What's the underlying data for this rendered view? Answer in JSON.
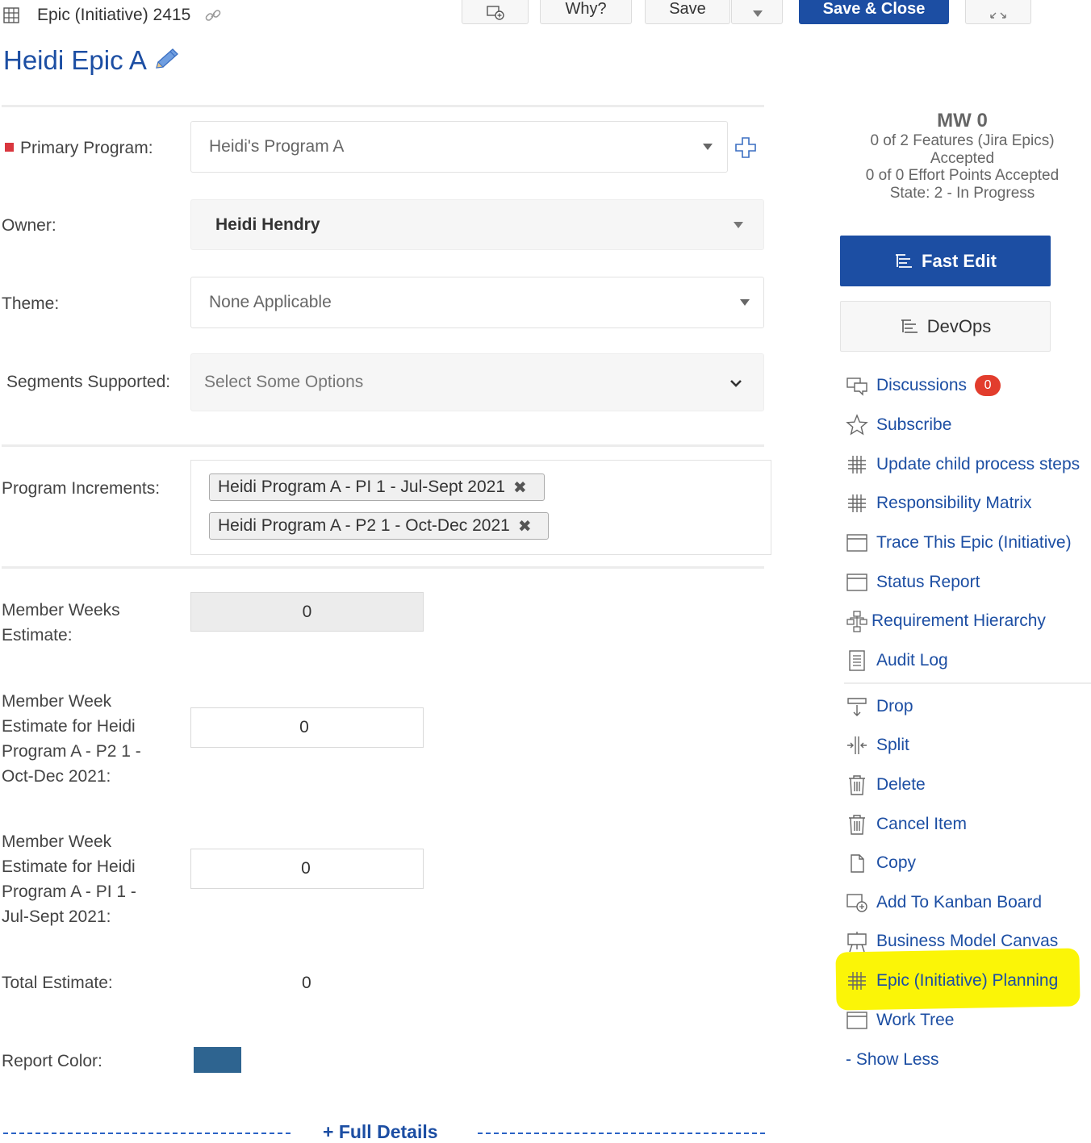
{
  "header": {
    "item_type_id": "Epic (Initiative) 2415",
    "title": "Heidi Epic A",
    "buttons": {
      "why": "Why?",
      "save": "Save",
      "save_close": "Save & Close"
    }
  },
  "form": {
    "primary_program": {
      "label": "Primary Program:",
      "value": "Heidi's Program A"
    },
    "owner": {
      "label": "Owner:",
      "value": "Heidi Hendry"
    },
    "theme": {
      "label": "Theme:",
      "value": "None Applicable"
    },
    "segments": {
      "label": "Segments Supported:",
      "placeholder": "Select Some Options"
    },
    "program_increments": {
      "label": "Program Increments:",
      "tags": [
        "Heidi Program A - PI 1 - Jul-Sept 2021",
        "Heidi Program A - P2 1 - Oct-Dec 2021"
      ]
    },
    "member_weeks": {
      "label_lines": [
        "Member Weeks",
        "Estimate:"
      ],
      "value": "0"
    },
    "mw_p2": {
      "label_lines": [
        "Member Week",
        "Estimate for Heidi",
        "Program A - P2 1 -",
        "Oct-Dec 2021:"
      ],
      "value": "0"
    },
    "mw_pi1": {
      "label_lines": [
        "Member Week",
        "Estimate for Heidi",
        "Program A - PI 1 -",
        "Jul-Sept 2021:"
      ],
      "value": "0"
    },
    "total": {
      "label": "Total Estimate:",
      "value": "0"
    },
    "report_color": {
      "label": "Report Color:",
      "color": "#2e6490"
    },
    "full_details": "+ Full Details"
  },
  "sidebar": {
    "stats": {
      "mw": "MW 0",
      "features": "0 of 2 Features (Jira Epics)",
      "accepted": "Accepted",
      "effort": "0 of 0 Effort Points Accepted",
      "state": "State: 2 - In Progress"
    },
    "fast_edit": "Fast Edit",
    "devops": "DevOps",
    "discussions_count": "0",
    "menu": [
      {
        "label": "Discussions",
        "icon": "discussions-icon"
      },
      {
        "label": "Subscribe",
        "icon": "star-icon"
      },
      {
        "label": "Update child process steps",
        "icon": "grid-hash-icon"
      },
      {
        "label": "Responsibility Matrix",
        "icon": "grid-hash-icon"
      },
      {
        "label": "Trace This Epic (Initiative)",
        "icon": "window-icon"
      },
      {
        "label": "Status Report",
        "icon": "window-icon"
      },
      {
        "label": "Requirement Hierarchy",
        "icon": "hierarchy-icon"
      },
      {
        "label": "Audit Log",
        "icon": "document-list-icon"
      },
      {
        "label": "Drop",
        "icon": "drop-icon"
      },
      {
        "label": "Split",
        "icon": "split-icon"
      },
      {
        "label": "Delete",
        "icon": "trash-icon"
      },
      {
        "label": "Cancel Item",
        "icon": "trash-icon"
      },
      {
        "label": "Copy",
        "icon": "copy-icon"
      },
      {
        "label": "Add To Kanban Board",
        "icon": "kanban-add-icon"
      },
      {
        "label": "Business Model Canvas",
        "icon": "easel-icon"
      },
      {
        "label": "Epic (Initiative) Planning",
        "icon": "grid-hash-icon"
      },
      {
        "label": "Work Tree",
        "icon": "window-icon"
      },
      {
        "label": "- Show Less",
        "icon": ""
      }
    ],
    "highlight_color": "#fbf507"
  }
}
